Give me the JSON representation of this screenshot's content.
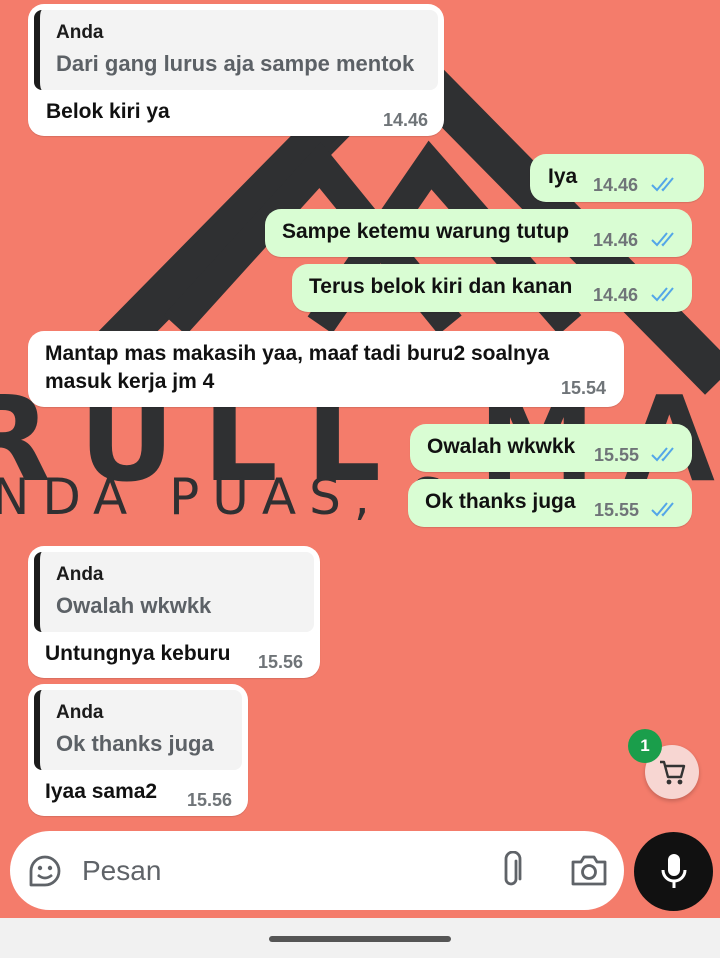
{
  "wallpaper": {
    "title": "RULL MASSA",
    "subtitle": "NDA PUAS, S",
    "subtitle_end": "A"
  },
  "messages": [
    {
      "direction": "in",
      "quote_name": "Anda",
      "quote_text": "Dari gang lurus aja sampe mentok",
      "text": "Belok kiri ya",
      "time": "14.46"
    },
    {
      "direction": "out",
      "text": "Iya",
      "time": "14.46",
      "status": "read"
    },
    {
      "direction": "out",
      "text": "Sampe ketemu warung tutup",
      "time": "14.46",
      "status": "read"
    },
    {
      "direction": "out",
      "text": "Terus belok kiri dan kanan",
      "time": "14.46",
      "status": "read"
    },
    {
      "direction": "in",
      "text_line1": "Mantap mas makasih yaa, maaf tadi buru2 soalnya",
      "text_line2": "masuk kerja jm 4",
      "time": "15.54"
    },
    {
      "direction": "out",
      "text": "Owalah wkwkk",
      "time": "15.55",
      "status": "read"
    },
    {
      "direction": "out",
      "text": "Ok thanks juga",
      "time": "15.55",
      "status": "read"
    },
    {
      "direction": "in",
      "quote_name": "Anda",
      "quote_text": "Owalah wkwkk",
      "text": "Untungnya keburu",
      "time": "15.56"
    },
    {
      "direction": "in",
      "quote_name": "Anda",
      "quote_text": "Ok thanks juga",
      "text": "Iyaa sama2",
      "time": "15.56"
    }
  ],
  "cart": {
    "badge_count": "1",
    "icon": "cart-icon"
  },
  "composer": {
    "placeholder": "Pesan",
    "icons": [
      "sticker-icon",
      "attach-icon",
      "camera-icon",
      "mic-icon"
    ]
  },
  "colors": {
    "background": "#f47c6b",
    "outgoing": "#d9fdd3",
    "incoming": "#ffffff",
    "read_ticks": "#53a6e8",
    "badge": "#1a9e4b"
  }
}
